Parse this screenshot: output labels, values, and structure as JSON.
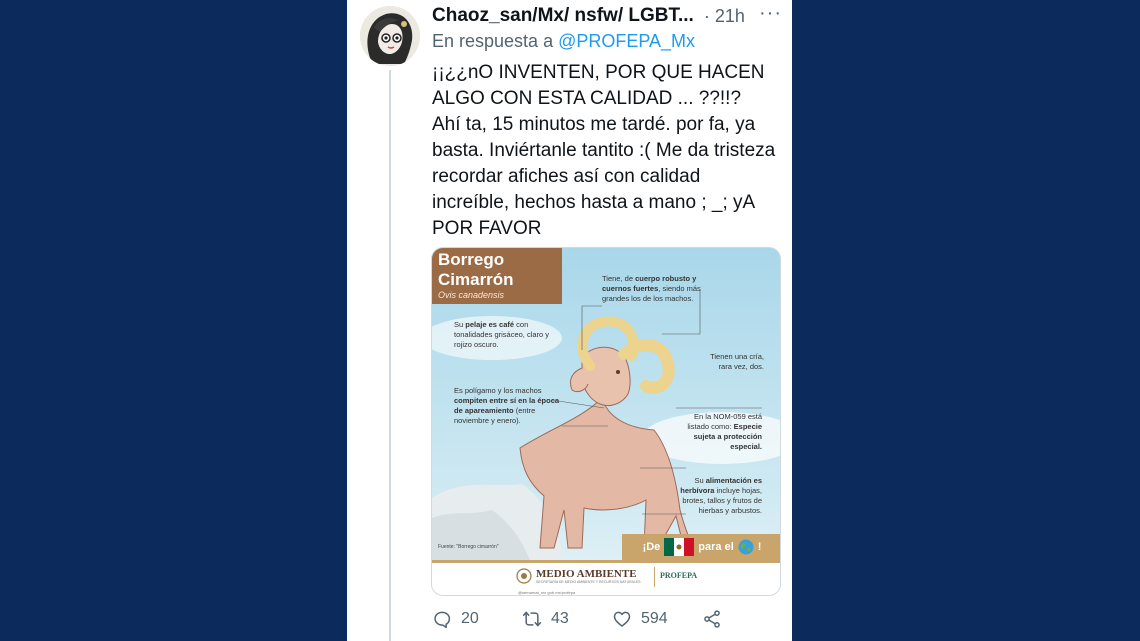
{
  "tweet": {
    "author": "Chaoz_san/Mx/ nsfw/ LGBT...",
    "separator": "·",
    "time": "21h",
    "more_label": "···",
    "reply_prefix": "En respuesta a",
    "reply_handle": "@PROFEPA_Mx",
    "text_lines": [
      "¡¡¿¿nO INVENTEN, POR QUE HACEN ALGO CON ESTA CALIDAD ... ??!!?",
      "Ahí ta, 15 minutos me tardé. por fa, ya basta. Inviértanle tantito :( Me da tristeza recordar afiches así con calidad increíble, hechos hasta a mano ; _; yA POR FAVOR"
    ],
    "reply_count": "20",
    "retweet_count": "43",
    "like_count": "594"
  },
  "poster": {
    "title_line1": "Borrego",
    "title_line2": "Cimarrón",
    "scientific_name": "Ovis canadensis",
    "fact_body": [
      "Tiene, de ",
      "cuerpo robusto y cuernos fuertes",
      ", siendo más grandes los de los machos."
    ],
    "fact_fur": [
      "Su ",
      "pelaje es café",
      " con tonalidades grisáceo, claro y rojizo oscuro."
    ],
    "fact_offspring": "Tienen una cría, rara vez, dos.",
    "fact_mating": [
      "Es polígamo y los machos ",
      "compiten entre sí en la época de apareamiento",
      " (entre noviembre y enero)."
    ],
    "fact_nom": [
      "En la NOM-059 está listado como: ",
      "Especie sujeta a protección especial."
    ],
    "fact_diet": [
      "Su ",
      "alimentación es herbívora",
      " incluye hojas, brotes, tallos y frutos de hierbas y arbustos."
    ],
    "footer_source": "Fuente: \"Borrego cimarrón\"",
    "slogan_start": "¡De",
    "slogan_mid": "para el",
    "slogan_end": "!",
    "ministry_name": "MEDIO AMBIENTE",
    "ministry_sub": "SECRETARÍA DE MEDIO AMBIENTE Y RECURSOS NATURALES",
    "agency_name": "PROFEPA",
    "social_handle": "@semarnat_mx   gob.mx/profepa"
  },
  "colors": {
    "background": "#0d2a5c",
    "link": "#1d9bf0",
    "title_banner": "#9a6b45",
    "footer_band": "#c9a46b"
  }
}
